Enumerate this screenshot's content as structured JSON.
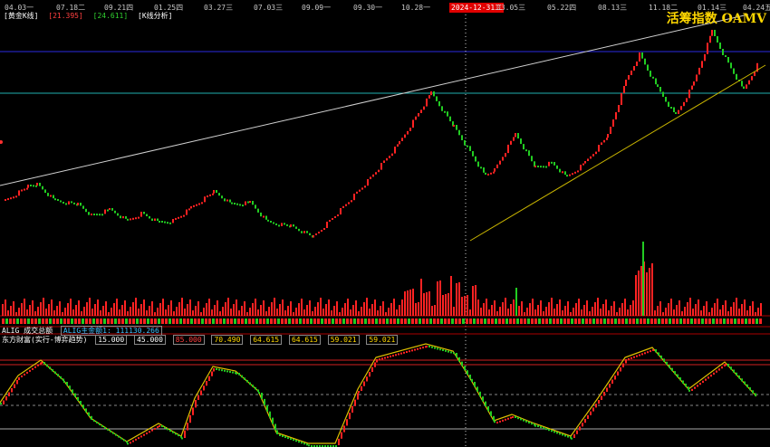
{
  "dates": [
    "04.03一",
    "07.18二",
    "09.21四",
    "01.25四",
    "03.27三",
    "07.03三",
    "09.09一",
    "09.30一",
    "10.28一",
    "2024-12-31二",
    "03.05三",
    "05.22四",
    "08.13三",
    "11.18二",
    "01.14三",
    "04.24五"
  ],
  "highlight_date_index": 9,
  "header": {
    "title": "[黄金K线]",
    "value1": "[21.395]",
    "value2": "[24.611]",
    "analysis": "[K线分析]"
  },
  "brand": {
    "text": "活筹指数 OAMV"
  },
  "volume_header": {
    "label": "ALIG 成交总额",
    "value": "ALIG主金额1: 111130.266"
  },
  "indicator_header": {
    "title": "东方财富(实行-博弈趋势)",
    "values": [
      "15.000",
      "45.000",
      "85.000",
      "70.490",
      "64.615",
      "64.615",
      "59.021",
      "59.021"
    ]
  },
  "colors": {
    "background": "#000000",
    "up": "#ff2222",
    "down": "#22cc22",
    "trendline_white": "#d0d0d0",
    "trendline_yellow": "#c8b400",
    "hline_blue": "#2a2adf",
    "hline_cyan": "#20b0b0",
    "divider": "#aa0000",
    "ind_red": "#d02020",
    "ind_white": "#aaaaaa",
    "ind_yellow": "#e0c000"
  }
}
